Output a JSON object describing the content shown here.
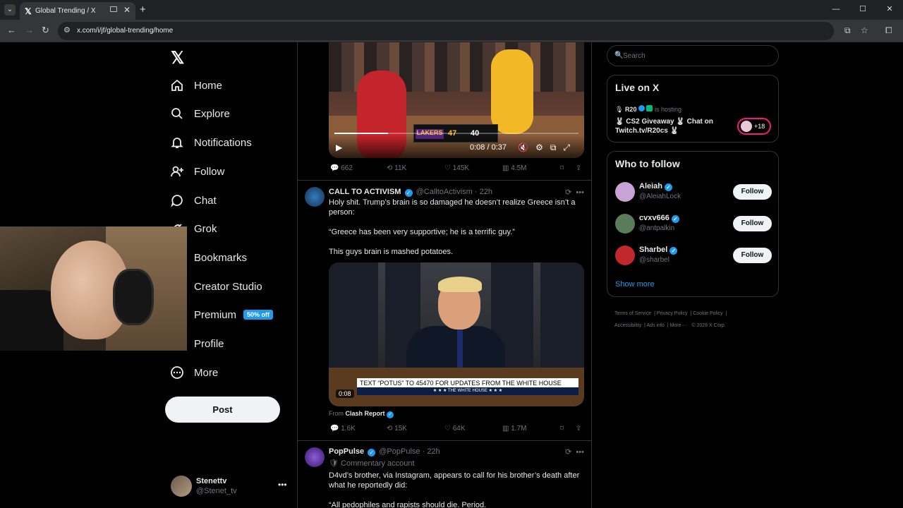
{
  "browser": {
    "tab_title": "Global Trending / X",
    "url": "x.com/i/jf/global-trending/home"
  },
  "nav": {
    "items": [
      {
        "label": "Home",
        "icon": "home-icon"
      },
      {
        "label": "Explore",
        "icon": "search-icon"
      },
      {
        "label": "Notifications",
        "icon": "bell-icon"
      },
      {
        "label": "Follow",
        "icon": "person-plus-icon"
      },
      {
        "label": "Chat",
        "icon": "chat-icon"
      },
      {
        "label": "Grok",
        "icon": "grok-icon"
      },
      {
        "label": "Bookmarks",
        "icon": "bookmark-icon"
      },
      {
        "label": "Creator Studio",
        "icon": "creator-studio-icon"
      },
      {
        "label": "Premium",
        "icon": "premium-icon",
        "badge": "50% off"
      },
      {
        "label": "Profile",
        "icon": "profile-icon"
      },
      {
        "label": "More",
        "icon": "more-circle-icon"
      }
    ],
    "post_label": "Post",
    "account": {
      "name": "Stenettv",
      "handle": "@Stenet_tv"
    }
  },
  "feed": {
    "video1": {
      "time": "0:08 / 0:37",
      "progress": 0.22,
      "scoreboard": {
        "team": "LAKERS",
        "score_a": "47",
        "score_b": "40"
      },
      "stats": {
        "replies": "662",
        "reposts": "11K",
        "likes": "145K",
        "views": "4.5M"
      }
    },
    "tweet2": {
      "name": "CALL TO ACTIVISM",
      "handle": "@CalltoActivism",
      "time": "22h",
      "text1": "Holy shit. Trump’s brain is so damaged he doesn’t realize Greece isn’t a person:",
      "text2": "“Greece has been very supportive; he is a terrific guy.”",
      "text3": "This guys brain is mashed potatoes.",
      "chyron": "TEXT “POTUS” TO 45470 FOR UPDATES FROM THE WHITE HOUSE",
      "chyron_sub": "★ ★ ★ THE WHITE HOUSE ★ ★ ★",
      "video_time": "0:08",
      "from_label": "From",
      "from_name": "Clash Report",
      "stats": {
        "replies": "1.6K",
        "reposts": "15K",
        "likes": "64K",
        "views": "1.7M"
      }
    },
    "tweet3": {
      "name": "PopPulse",
      "handle": "@PopPulse",
      "time": "22h",
      "community": "Commentary account",
      "text1": "D4vd’s brother, via Instagram, appears to call for his brother’s death after what he reportedly  did:",
      "text2": "“All pedophiles and rapists should die. Period."
    }
  },
  "sidebar": {
    "search_placeholder": "Search",
    "live": {
      "title": "Live on X",
      "host": "R20",
      "host_suffix": "is hosting",
      "stream_title": "🐰 CS2 Giveaway 🐰 Chat on Twitch.tv/R20cs 🐰",
      "listeners": "+18"
    },
    "who_to_follow": {
      "title": "Who to follow",
      "users": [
        {
          "name": "Aleiah",
          "handle": "@AleiahLock",
          "button": "Follow",
          "color": "#c9a3d6"
        },
        {
          "name": "cvxv666",
          "handle": "@antpalkin",
          "button": "Follow",
          "color": "#5b7c5a"
        },
        {
          "name": "Sharbel",
          "handle": "@sharbel",
          "button": "Follow",
          "color": "#c0282d"
        }
      ],
      "show_more": "Show more"
    },
    "footer": [
      "Terms of Service",
      "Privacy Policy",
      "Cookie Policy",
      "Accessibility",
      "Ads info",
      "More ···",
      "© 2026 X Corp."
    ]
  }
}
